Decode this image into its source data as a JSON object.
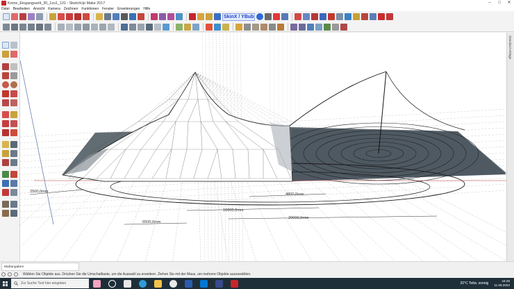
{
  "window": {
    "title": "Krone_Eingangszelt_30_1zu1_131 - SketchUp Make 2017"
  },
  "menu": [
    "Datei",
    "Bearbeiten",
    "Ansicht",
    "Kamera",
    "Zeichnen",
    "Funktionen",
    "Fenster",
    "Erweiterungen",
    "Hilfe"
  ],
  "toolbar": {
    "skinx_label": "SkinX / YBub"
  },
  "right_panel": {
    "label": "Standard-Ablage"
  },
  "dimensions": {
    "d1": "2500,0mm",
    "d2": "4800,0mm",
    "d3": "10000,0mm",
    "d4": "20000,0mm",
    "d5": "6500,0mm"
  },
  "measurements": {
    "label": "Maßangaben"
  },
  "status": {
    "text": "Wählen Sie Objekte aus. Drücken Sie die Umschalttaste, um die Auswahl zu erweitern. Ziehen Sie mit der Maus, um mehrere Objekte auszuwählen."
  },
  "taskbar": {
    "search_placeholder": "Zur Suche Text hier eingeben",
    "weather": "20°C  Teilw. sonnig",
    "time": "16:26",
    "date": "11.09.2022"
  },
  "colors": {
    "accent": "#c8262b",
    "taskbar": "#1f2f3a",
    "plate": "#5a646c"
  }
}
